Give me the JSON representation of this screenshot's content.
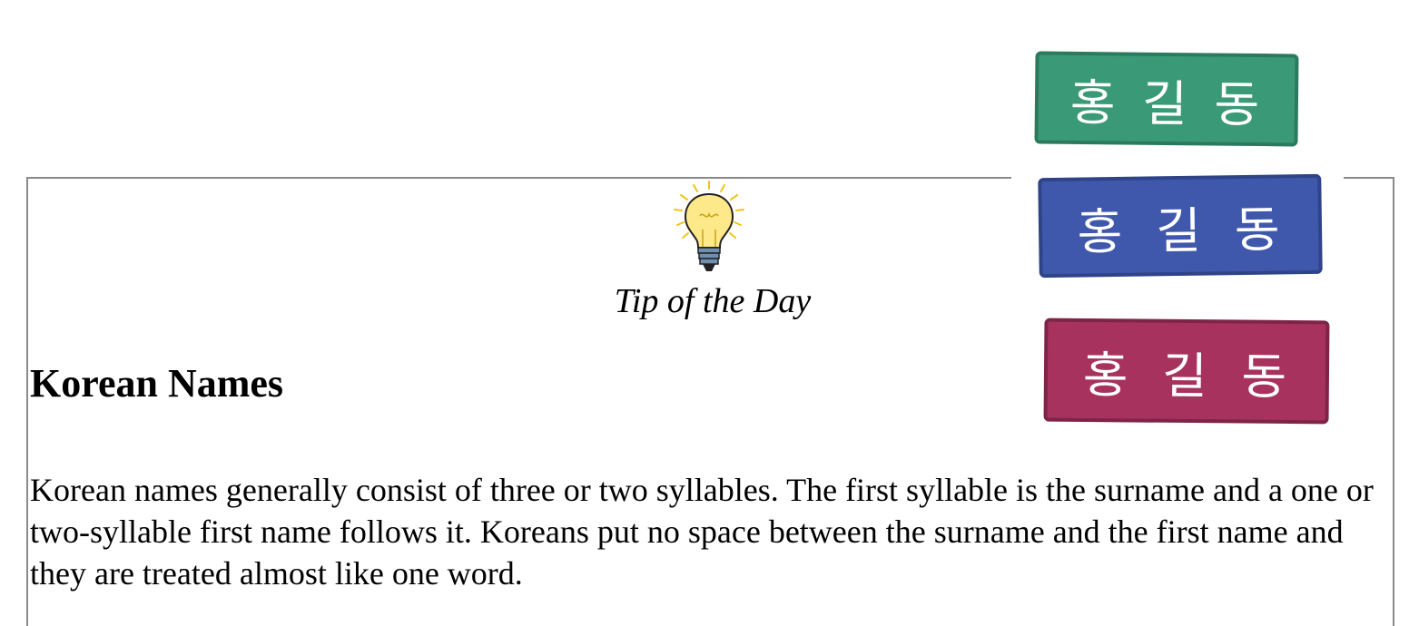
{
  "tip": {
    "title": "Tip of the Day",
    "heading": "Korean Names",
    "body": "Korean names generally consist of three or two syllables.  The first syllable is the surname and a one or two-syllable first name follows it.  Koreans put no space between the surname and the first name and they are treated almost like one word."
  },
  "badges": [
    {
      "syllables": [
        "홍",
        "길",
        "동"
      ],
      "color": "#3a9a78",
      "border": "#2c7a5e"
    },
    {
      "syllables": [
        "홍",
        "길",
        "동"
      ],
      "color": "#3f58ac",
      "border": "#2f4488"
    },
    {
      "syllables": [
        "홍",
        "길",
        "동"
      ],
      "color": "#a8325e",
      "border": "#7e2446"
    }
  ],
  "icons": {
    "bulb": "lightbulb-icon"
  },
  "colors": {
    "border": "#8a8a8a",
    "bulb_glass": "#fde98a",
    "bulb_base": "#6f8fb0"
  }
}
